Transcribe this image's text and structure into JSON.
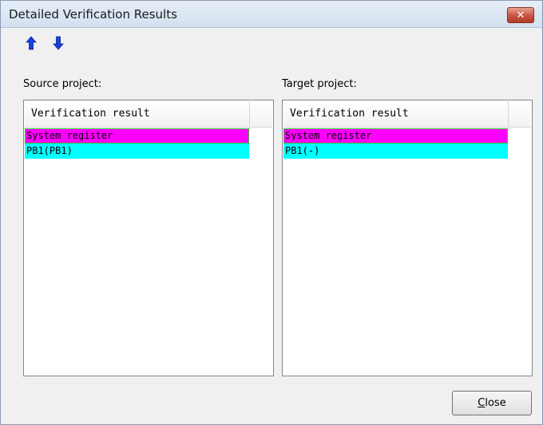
{
  "window": {
    "title": "Detailed Verification Results",
    "close_glyph": "✕"
  },
  "toolbar": {
    "prev_icon": "arrow-up-icon",
    "next_icon": "arrow-down-icon",
    "arrow_color": "#1a3fe0"
  },
  "source": {
    "label": "Source project:",
    "column_header": "Verification result",
    "rows": [
      {
        "text": "System register",
        "color": "#ff00ff"
      },
      {
        "text": "PB1(PB1)",
        "color": "#00ffff"
      }
    ]
  },
  "target": {
    "label": "Target project:",
    "column_header": "Verification result",
    "rows": [
      {
        "text": "System register",
        "color": "#ff00ff"
      },
      {
        "text": "PB1(-)",
        "color": "#00ffff"
      }
    ]
  },
  "footer": {
    "close_mnemonic": "C",
    "close_rest": "lose"
  }
}
